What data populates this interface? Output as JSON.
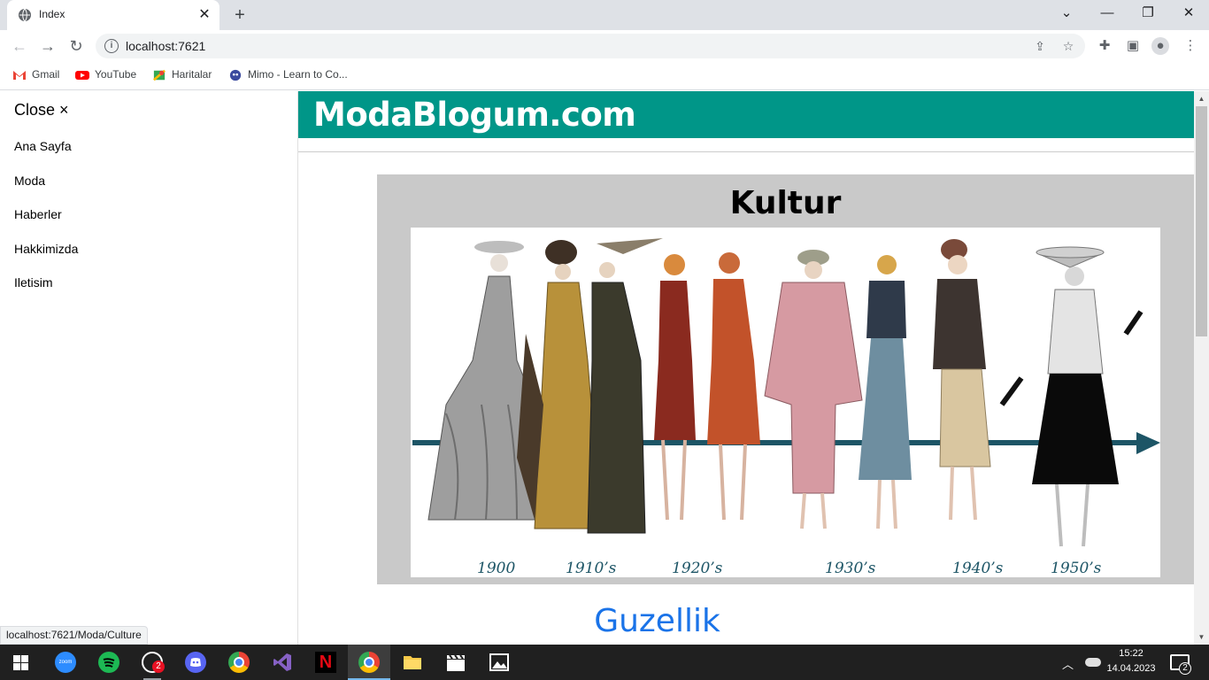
{
  "browser": {
    "tab_title": "Index",
    "url": "localhost:7621",
    "bookmarks": [
      "Gmail",
      "YouTube",
      "Haritalar",
      "Mimo - Learn to Co..."
    ]
  },
  "sidenav": {
    "close_label": "Close ×",
    "items": [
      "Ana Sayfa",
      "Moda",
      "Haberler",
      "Hakkimizda",
      "Iletisim"
    ]
  },
  "page": {
    "site_title": "ModaBlogum.com",
    "culture_title": "Kultur",
    "timeline_labels": [
      "1900",
      "1910’s",
      "1920’s",
      "1930’s",
      "1940’s",
      "1950’s"
    ],
    "beauty_heading": "Guzellik"
  },
  "status_bar": {
    "link": "localhost:7621/Moda/Culture"
  },
  "taskbar": {
    "apps": [
      "start",
      "zoom",
      "spotify",
      "whatsapp",
      "discord",
      "chrome",
      "visual-studio",
      "netflix",
      "chrome",
      "file-explorer",
      "video-editor",
      "photos"
    ],
    "whatsapp_badge": "2",
    "clock_time": "15:22",
    "clock_date": "14.04.2023",
    "notification_count": "2"
  },
  "colors": {
    "header": "#009688",
    "card_bg": "#c9c9c9",
    "heading_blue": "#1a73e8",
    "timeline_arrow": "#1d5566"
  }
}
